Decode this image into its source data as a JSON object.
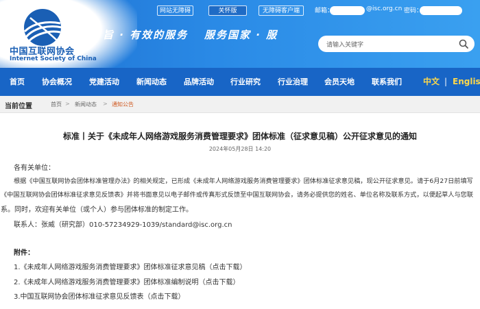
{
  "header": {
    "org_name_cn": "中国互联网协会",
    "org_name_en": "Internet Society of China",
    "slogan_left": "旨 · 有效的服务",
    "slogan_right": "服务国家 · 服",
    "accessibility_link": "网站无障碍",
    "care_mode_button": "关怀版",
    "accessible_client_link": "无障碍客户端",
    "email_label": "邮箱：",
    "email_domain": "@isc.org.cn",
    "password_label": "密码：",
    "search_placeholder": "请输入关键字"
  },
  "nav": {
    "items": [
      "首页",
      "协会概况",
      "党建活动",
      "新闻动态",
      "品牌活动",
      "行业研究",
      "行业治理",
      "会员天地",
      "联系我们"
    ],
    "lang_cn": "中文",
    "lang_sep": "|",
    "lang_en": "English"
  },
  "breadcrumb": {
    "title": "当前位置",
    "items": [
      "首页",
      "新闻动态",
      "通知公告"
    ],
    "sep": ">"
  },
  "article": {
    "title": "标准丨关于《未成年人网络游戏服务消费管理要求》团体标准（征求意见稿）公开征求意见的通知",
    "date": "2024年05月28日 14:20",
    "greeting": "各有关单位：",
    "body_line1": "根据《中国互联网协会团体标准管理办法》的相关规定，已形成《未成年人网络游戏服务消费管理要求》团体标准征求意见稿，现公开征求意见。请于6月27日前填写",
    "body_line2": "《中国互联网协会团体标准征求意见反馈表》并将书面意见以电子邮件或传真形式反馈至中国互联网协会，请务必提供您的姓名、单位名称及联系方式，以便起草人与您联",
    "body_line3": "系。同时，欢迎有关单位（或个人）参与团体标准的制定工作。",
    "contact": "联系人：张威（研究部）010-57234929-1039/standard@isc.org.cn",
    "attachments_label": "附件：",
    "attachments": [
      "1.《未成年人网络游戏服务消费管理要求》团体标准征求意见稿（点击下载）",
      "2.《未成年人网络游戏服务消费管理要求》团体标准编制说明（点击下载）",
      "3.中国互联网协会团体标准征求意见反馈表（点击下载）"
    ]
  },
  "colors": {
    "header_blue": "#2a8ae6",
    "nav_blue": "#1865c6",
    "lang_active": "#ffd84a",
    "crumb_current": "#d05a22"
  }
}
